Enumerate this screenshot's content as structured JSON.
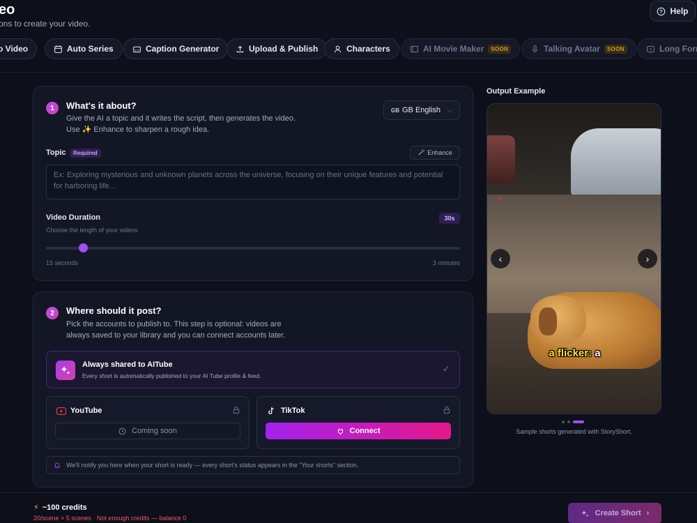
{
  "header": {
    "title": "eo",
    "subtitle": "ons to create your video.",
    "help_label": "Help"
  },
  "tabs": [
    {
      "label": "to Video",
      "icon": "video-icon",
      "disabled": false
    },
    {
      "label": "Auto Series",
      "icon": "calendar-icon",
      "disabled": false
    },
    {
      "label": "Caption Generator",
      "icon": "caption-icon",
      "disabled": false
    },
    {
      "label": "Upload & Publish",
      "icon": "upload-icon",
      "disabled": false
    },
    {
      "label": "Characters",
      "icon": "user-icon",
      "disabled": false
    },
    {
      "label": "AI Movie Maker",
      "icon": "film-icon",
      "disabled": true,
      "badge": "SOON"
    },
    {
      "label": "Talking Avatar",
      "icon": "microphone-icon",
      "disabled": true,
      "badge": "SOON"
    },
    {
      "label": "Long Form",
      "icon": "play-icon",
      "disabled": true
    }
  ],
  "step1": {
    "number": "1",
    "title": "What's it about?",
    "desc_line1": "Give the AI a topic and it writes the script, then generates the video.",
    "desc_line2_pre": "Use",
    "desc_line2_post": "Enhance to sharpen a rough idea.",
    "language_code": "GB",
    "language": "GB English",
    "topic_label": "Topic",
    "required_label": "Required",
    "enhance_label": "Enhance",
    "topic_placeholder": "Ex: Exploring mysterious and unknown planets across the universe, focusing on their unique features and potential for harboring life...",
    "duration_label": "Video Duration",
    "duration_hint": "Choose the length of your videos",
    "duration_value": "30s",
    "duration_fraction": 0.09,
    "min_label": "15 seconds",
    "max_label": "3 minutes"
  },
  "step2": {
    "number": "2",
    "title": "Where should it post?",
    "desc_line1": "Pick the accounts to publish to. This step is optional: videos are",
    "desc_line2": "always saved to your library and you can connect accounts later.",
    "aitube_title": "Always shared to AITube",
    "aitube_desc": "Every short is automatically published to your AI Tube profile & feed.",
    "youtube_label": "YouTube",
    "youtube_action": "Coming soon",
    "tiktok_label": "TikTok",
    "tiktok_action": "Connect",
    "notify_text": "We'll notify you here when your short is ready — every short's status appears in the \"Your shorts\" section."
  },
  "output": {
    "title": "Output Example",
    "caption_word1": "a flicker:",
    "caption_word2": "a",
    "note": "Sample shorts generated with StoryShort."
  },
  "footer": {
    "credits": "~100 credits",
    "warning": "20/scene × 5 scenes · Not enough credits — balance 0",
    "create_label": "Create Short"
  },
  "colors": {
    "accent": "#a24ef0",
    "background": "#0d0f1a",
    "card": "#131624",
    "warning": "#f05a5a"
  }
}
